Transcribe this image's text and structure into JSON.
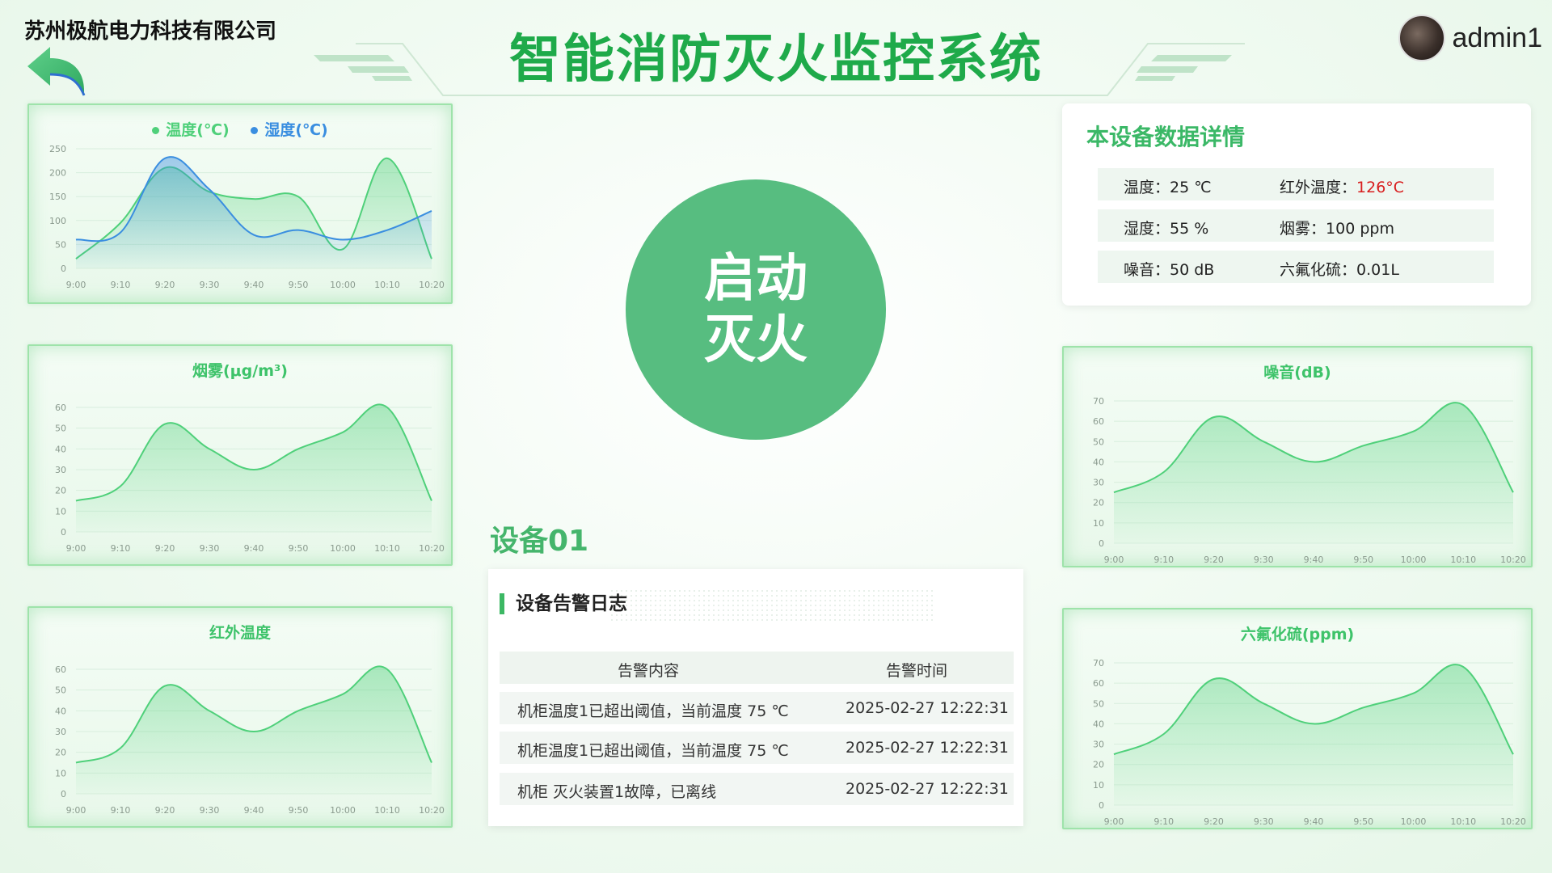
{
  "header": {
    "company": "苏州极航电力科技有限公司",
    "title": "智能消防灭火监控系统",
    "username": "admin1"
  },
  "colors": {
    "primary_green": "#57bd80",
    "title_green": "#1faa4a",
    "line_green": "#4fd07a",
    "line_blue": "#3a8ee0",
    "alert_red": "#d81e1e"
  },
  "icons": {
    "back": "back-arrow-icon",
    "avatar": "user-avatar"
  },
  "center": {
    "button_line1": "启动",
    "button_line2": "灭火",
    "device_label": "设备01"
  },
  "detail": {
    "title": "本设备数据详情",
    "rows": [
      {
        "l_label": "温度：",
        "l_value": "25 ℃",
        "r_label": "红外温度：",
        "r_value": "126°C"
      },
      {
        "l_label": "湿度：",
        "l_value": "55 %",
        "r_label": "烟雾：",
        "r_value": "100 ppm"
      },
      {
        "l_label": "噪音：",
        "l_value": "50 dB",
        "r_label": "六氟化硫：",
        "r_value": "0.01L"
      }
    ]
  },
  "log": {
    "title": "设备告警日志",
    "headers": [
      "告警内容",
      "告警时间"
    ],
    "rows": [
      {
        "content": "机柜温度1已超出阈值，当前温度 75 ℃",
        "time": "2025-02-27 12:22:31"
      },
      {
        "content": "机柜温度1已超出阈值，当前温度 75 ℃",
        "time": "2025-02-27 12:22:31"
      },
      {
        "content": "机柜 灭火装置1故障，已离线",
        "time": "2025-02-27 12:22:31"
      }
    ]
  },
  "chart_data": [
    {
      "id": "temp-humidity",
      "type": "area",
      "title": "",
      "x": [
        "9:00",
        "9:10",
        "9:20",
        "9:30",
        "9:40",
        "9:50",
        "10:00",
        "10:10",
        "10:20"
      ],
      "ylim": [
        0,
        250
      ],
      "yticks": [
        0,
        50,
        100,
        150,
        200,
        250
      ],
      "series": [
        {
          "name": "温度(℃)",
          "color": "#4fd07a",
          "values": [
            20,
            95,
            210,
            160,
            145,
            150,
            40,
            230,
            20
          ]
        },
        {
          "name": "湿度(℃)",
          "color": "#3a8ee0",
          "values": [
            60,
            75,
            230,
            165,
            70,
            80,
            60,
            80,
            120
          ]
        }
      ],
      "legend": "top-center"
    },
    {
      "id": "smoke",
      "type": "area",
      "title": "烟雾(μg/m³)",
      "x": [
        "9:00",
        "9:10",
        "9:20",
        "9:30",
        "9:40",
        "9:50",
        "10:00",
        "10:10",
        "10:20"
      ],
      "ylim": [
        0,
        60
      ],
      "yticks": [
        0,
        10,
        20,
        30,
        40,
        50,
        60
      ],
      "series": [
        {
          "color": "#4fd07a",
          "values": [
            15,
            22,
            52,
            40,
            30,
            40,
            48,
            60,
            15
          ]
        }
      ]
    },
    {
      "id": "infrared",
      "type": "area",
      "title": "红外温度",
      "x": [
        "9:00",
        "9:10",
        "9:20",
        "9:30",
        "9:40",
        "9:50",
        "10:00",
        "10:10",
        "10:20"
      ],
      "ylim": [
        0,
        60
      ],
      "yticks": [
        0,
        10,
        20,
        30,
        40,
        50,
        60
      ],
      "series": [
        {
          "color": "#4fd07a",
          "values": [
            15,
            22,
            52,
            40,
            30,
            40,
            48,
            60,
            15
          ]
        }
      ]
    },
    {
      "id": "noise",
      "type": "area",
      "title": "噪音(dB)",
      "x": [
        "9:00",
        "9:10",
        "9:20",
        "9:30",
        "9:40",
        "9:50",
        "10:00",
        "10:10",
        "10:20"
      ],
      "ylim": [
        0,
        70
      ],
      "yticks": [
        0,
        10,
        20,
        30,
        40,
        50,
        60,
        70
      ],
      "series": [
        {
          "color": "#4fd07a",
          "values": [
            25,
            35,
            62,
            50,
            40,
            48,
            55,
            68,
            25
          ]
        }
      ]
    },
    {
      "id": "sf6",
      "type": "area",
      "title": "六氟化硫(ppm)",
      "x": [
        "9:00",
        "9:10",
        "9:20",
        "9:30",
        "9:40",
        "9:50",
        "10:00",
        "10:10",
        "10:20"
      ],
      "ylim": [
        0,
        70
      ],
      "yticks": [
        0,
        10,
        20,
        30,
        40,
        50,
        60,
        70
      ],
      "series": [
        {
          "color": "#4fd07a",
          "values": [
            25,
            35,
            62,
            50,
            40,
            48,
            55,
            68,
            25
          ]
        }
      ]
    }
  ]
}
